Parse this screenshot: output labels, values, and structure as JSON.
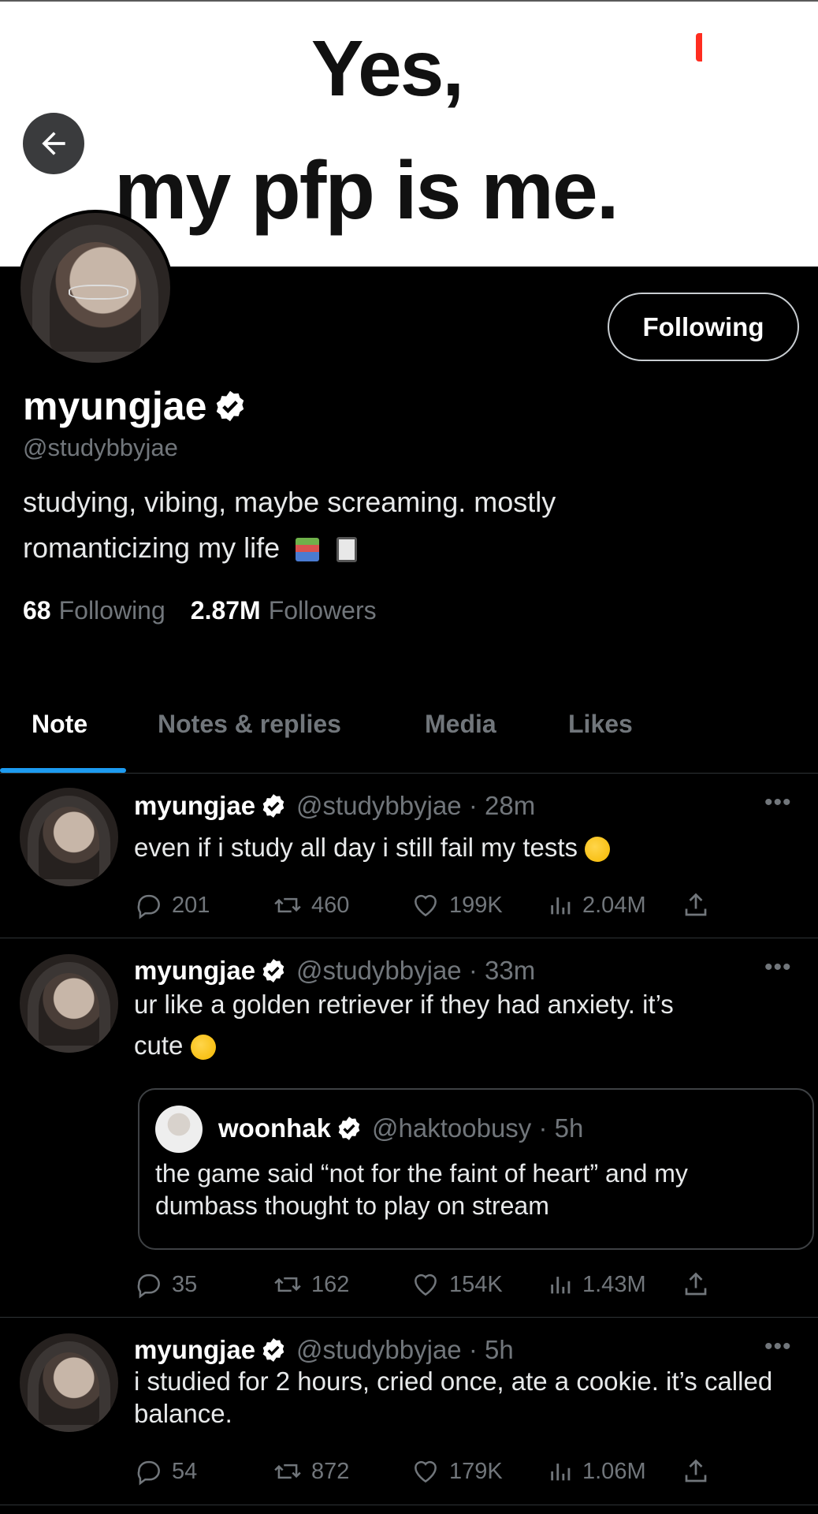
{
  "banner": {
    "line1": "Yes,",
    "line2": "my pfp is me."
  },
  "profile": {
    "name": "myungjae",
    "handle": "@studybbyjae",
    "follow_label": "Following",
    "bio_line1": "studying, vibing, maybe screaming. mostly",
    "bio_line2": "romanticizing my life",
    "bio_emojis": [
      "books-emoji",
      "notebook-emoji"
    ],
    "following_count": "68",
    "following_label": "Following",
    "followers_count": "2.87M",
    "followers_label": "Followers"
  },
  "tabs": [
    {
      "label": "Note",
      "active": true
    },
    {
      "label": "Notes & replies",
      "active": false
    },
    {
      "label": "Media",
      "active": false
    },
    {
      "label": "Likes",
      "active": false
    }
  ],
  "posts": [
    {
      "name": "myungjae",
      "meta": "@studybbyjae · 28m",
      "text": "even if i study all day i still fail my tests",
      "emoji": "crying-face-emoji",
      "replies": "201",
      "reposts": "460",
      "likes": "199K",
      "views": "2.04M"
    },
    {
      "name": "myungjae",
      "meta": "@studybbyjae · 33m",
      "text1": "ur like a golden retriever if they had anxiety. it’s",
      "text2": "cute",
      "emoji": "smiling-face-emoji",
      "quote": {
        "name": "woonhak",
        "meta": "@haktoobusy · 5h",
        "text": "the game said “not for the faint of heart” and my dumbass thought to play on stream"
      },
      "replies": "35",
      "reposts": "162",
      "likes": "154K",
      "views": "1.43M"
    },
    {
      "name": "myungjae",
      "meta": "@studybbyjae · 5h",
      "text": "i studied for 2 hours, cried once, ate a cookie. it’s called balance.",
      "replies": "54",
      "reposts": "872",
      "likes": "179K",
      "views": "1.06M"
    }
  ],
  "colors": {
    "accent": "#1d9bf0",
    "muted": "#71767b",
    "background": "#000000"
  }
}
